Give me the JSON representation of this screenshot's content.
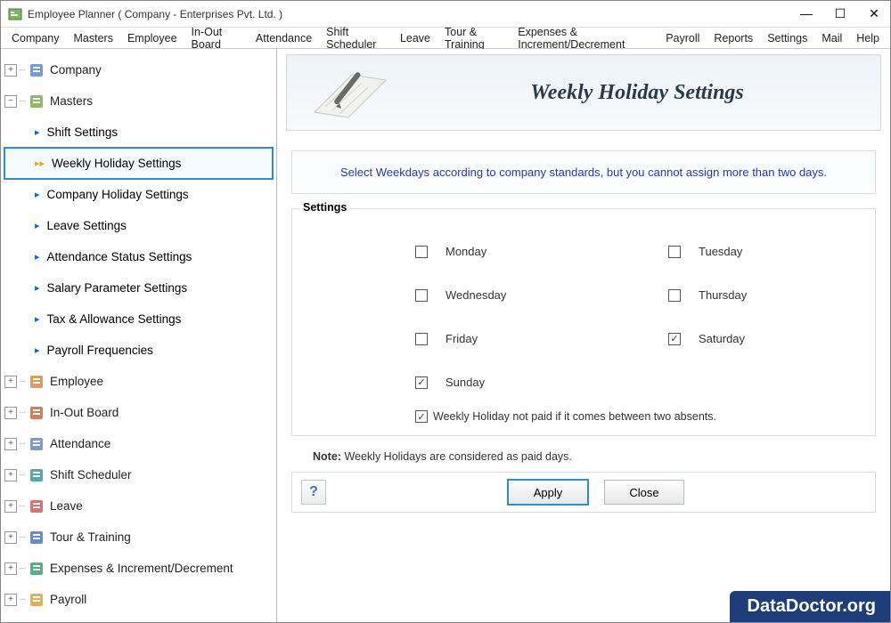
{
  "window": {
    "title": "Employee Planner ( Company - Enterprises Pvt. Ltd. )"
  },
  "menubar": [
    "Company",
    "Masters",
    "Employee",
    "In-Out Board",
    "Attendance",
    "Shift Scheduler",
    "Leave",
    "Tour & Training",
    "Expenses & Increment/Decrement",
    "Payroll",
    "Reports",
    "Settings",
    "Mail",
    "Help"
  ],
  "sidebar": {
    "nodes": [
      {
        "label": "Company",
        "icon": "building",
        "expanded": false
      },
      {
        "label": "Masters",
        "icon": "masters",
        "expanded": true,
        "children": [
          {
            "label": "Shift Settings",
            "selected": false
          },
          {
            "label": "Weekly Holiday Settings",
            "selected": true
          },
          {
            "label": "Company Holiday Settings",
            "selected": false
          },
          {
            "label": "Leave Settings",
            "selected": false
          },
          {
            "label": "Attendance Status Settings",
            "selected": false
          },
          {
            "label": "Salary Parameter Settings",
            "selected": false
          },
          {
            "label": "Tax & Allowance Settings",
            "selected": false
          },
          {
            "label": "Payroll Frequencies",
            "selected": false
          }
        ]
      },
      {
        "label": "Employee",
        "icon": "person",
        "expanded": false
      },
      {
        "label": "In-Out Board",
        "icon": "door",
        "expanded": false
      },
      {
        "label": "Attendance",
        "icon": "calendar",
        "expanded": false
      },
      {
        "label": "Shift Scheduler",
        "icon": "clock",
        "expanded": false
      },
      {
        "label": "Leave",
        "icon": "leave",
        "expanded": false
      },
      {
        "label": "Tour & Training",
        "icon": "plane",
        "expanded": false
      },
      {
        "label": "Expenses & Increment/Decrement",
        "icon": "money",
        "expanded": false
      },
      {
        "label": "Payroll",
        "icon": "coin",
        "expanded": false
      }
    ]
  },
  "page": {
    "title": "Weekly Holiday Settings",
    "instruction": "Select Weekdays according to company standards, but you cannot assign more than two days.",
    "settings_legend": "Settings",
    "days": [
      {
        "label": "Monday",
        "checked": false
      },
      {
        "label": "Tuesday",
        "checked": false
      },
      {
        "label": "Wednesday",
        "checked": false
      },
      {
        "label": "Thursday",
        "checked": false
      },
      {
        "label": "Friday",
        "checked": false
      },
      {
        "label": "Saturday",
        "checked": true
      },
      {
        "label": "Sunday",
        "checked": true
      }
    ],
    "paid_rule": {
      "label": "Weekly Holiday not paid if it comes between two absents.",
      "checked": true
    },
    "note_label": "Note:",
    "note_text": "Weekly Holidays are considered as paid days.",
    "buttons": {
      "apply": "Apply",
      "close": "Close"
    }
  },
  "watermark": "DataDoctor.org"
}
